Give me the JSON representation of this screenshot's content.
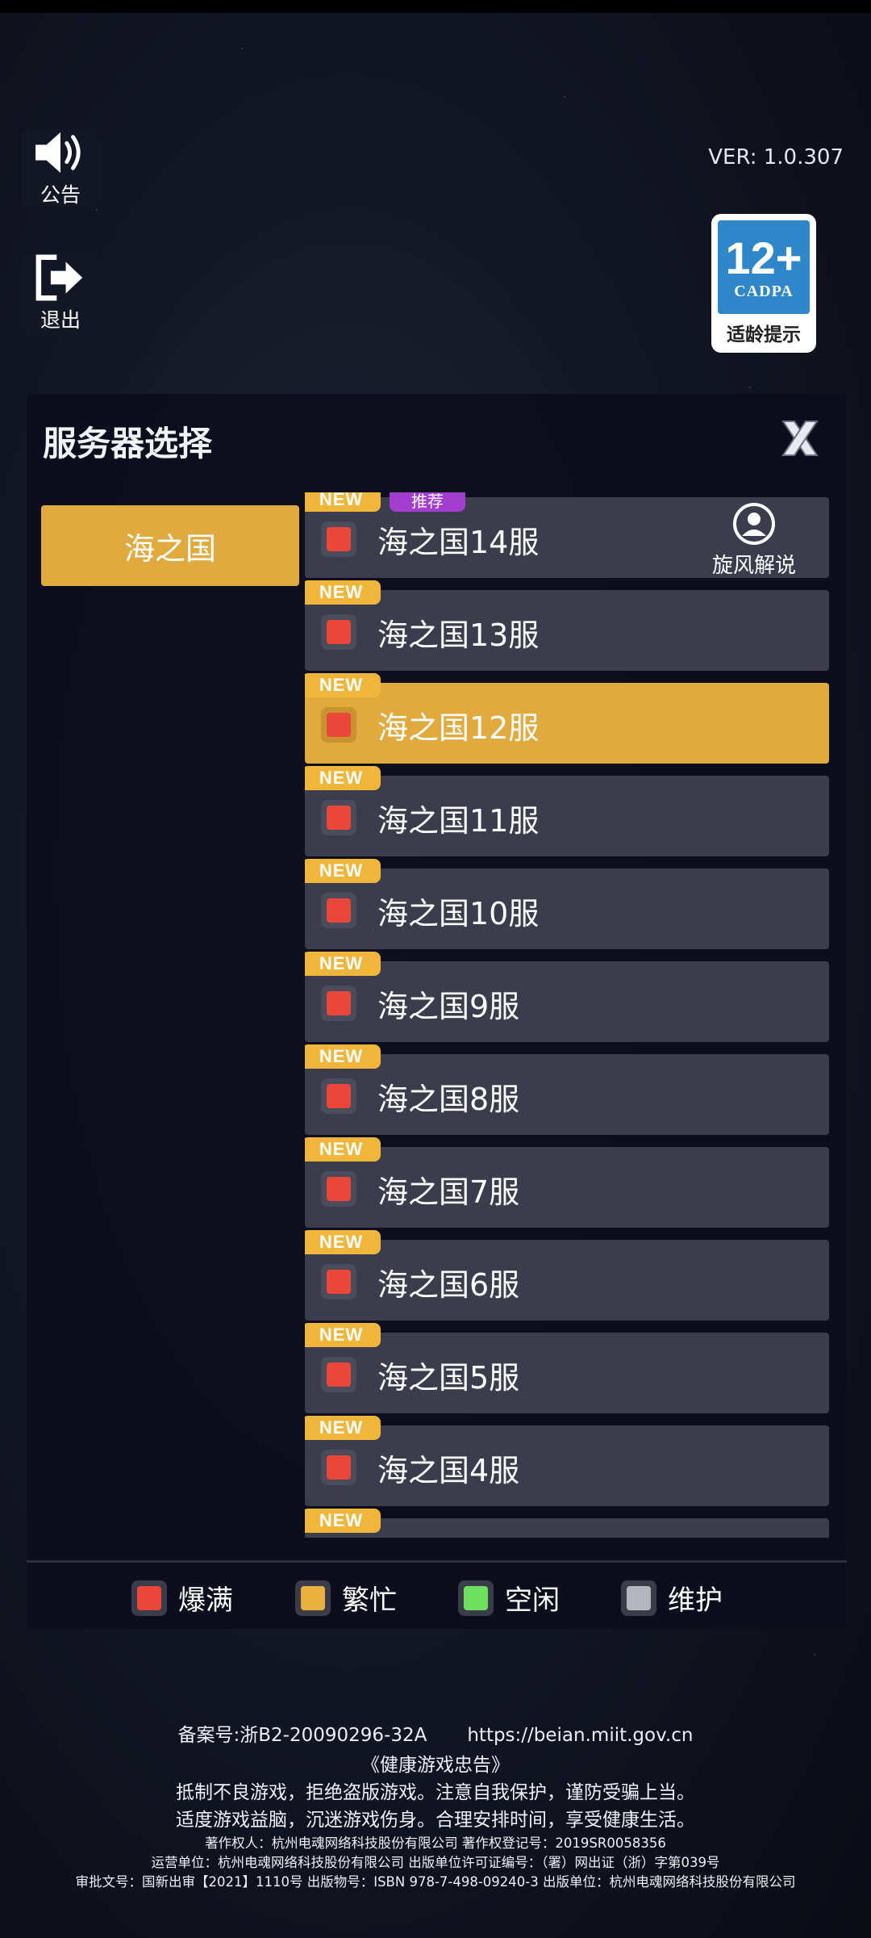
{
  "left_buttons": {
    "announcement_label": "公告",
    "logout_label": "退出"
  },
  "version": "VER: 1.0.307",
  "age_rating": {
    "number": "12+",
    "org": "CADPA",
    "tip": "适龄提示"
  },
  "panel": {
    "title": "服务器选择",
    "region": "海之国",
    "servers": [
      {
        "name": "海之国14服",
        "new_label": "NEW",
        "recommend_label": "推荐",
        "commentary_label": "旋风解说",
        "status": "爆满",
        "selected": false
      },
      {
        "name": "海之国13服",
        "new_label": "NEW",
        "status": "爆满",
        "selected": false
      },
      {
        "name": "海之国12服",
        "new_label": "NEW",
        "status": "爆满",
        "selected": true
      },
      {
        "name": "海之国11服",
        "new_label": "NEW",
        "status": "爆满",
        "selected": false
      },
      {
        "name": "海之国10服",
        "new_label": "NEW",
        "status": "爆满",
        "selected": false
      },
      {
        "name": "海之国9服",
        "new_label": "NEW",
        "status": "爆满",
        "selected": false
      },
      {
        "name": "海之国8服",
        "new_label": "NEW",
        "status": "爆满",
        "selected": false
      },
      {
        "name": "海之国7服",
        "new_label": "NEW",
        "status": "爆满",
        "selected": false
      },
      {
        "name": "海之国6服",
        "new_label": "NEW",
        "status": "爆满",
        "selected": false
      },
      {
        "name": "海之国5服",
        "new_label": "NEW",
        "status": "爆满",
        "selected": false
      },
      {
        "name": "海之国4服",
        "new_label": "NEW",
        "status": "爆满",
        "selected": false
      },
      {
        "name": "",
        "new_label": "NEW",
        "status": "爆满",
        "selected": false
      }
    ],
    "legend": [
      {
        "label": "爆满",
        "color": "#e8473a"
      },
      {
        "label": "繁忙",
        "color": "#e9b23f"
      },
      {
        "label": "空闲",
        "color": "#6ee05f"
      },
      {
        "label": "维护",
        "color": "#b5b6bb"
      }
    ]
  },
  "footer": {
    "icp": "备案号:浙B2-20090296-32A",
    "url": "https://beian.miit.gov.cn",
    "notice_title": "《健康游戏忠告》",
    "notice_line1": "抵制不良游戏，拒绝盗版游戏。注意自我保护，谨防受骗上当。",
    "notice_line2": "适度游戏益脑，沉迷游戏伤身。合理安排时间，享受健康生活。",
    "copyright": "著作权人：杭州电魂网络科技股份有限公司 著作权登记号：2019SR0058356",
    "operator": "运营单位：杭州电魂网络科技股份有限公司 出版单位许可证编号：（署）网出证（浙）字第039号",
    "approval": "审批文号：国新出审【2021】1110号 出版物号：ISBN 978-7-498-09240-3 出版单位：杭州电魂网络科技股份有限公司"
  }
}
